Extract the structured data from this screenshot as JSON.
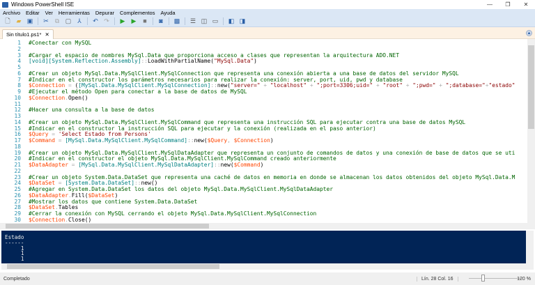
{
  "window": {
    "title": "Windows PowerShell ISE",
    "minimize": "—",
    "restore": "❐",
    "close": "✕"
  },
  "menu": [
    "Archivo",
    "Editar",
    "Ver",
    "Herramientas",
    "Depurar",
    "Complementos",
    "Ayuda"
  ],
  "toolbar": [
    {
      "icon": "new-file-icon",
      "glyph": "🗋",
      "color": "#555"
    },
    {
      "icon": "open-folder-icon",
      "glyph": "▰",
      "color": "#e0b040"
    },
    {
      "icon": "save-icon",
      "glyph": "▣",
      "color": "#2a5fa6"
    },
    {
      "sep": true
    },
    {
      "icon": "cut-icon",
      "glyph": "✂",
      "color": "#2a5fa6"
    },
    {
      "icon": "copy-icon",
      "glyph": "⧉",
      "color": "#aaa"
    },
    {
      "icon": "paste-icon",
      "glyph": "▢",
      "color": "#666"
    },
    {
      "icon": "clear-console-icon",
      "glyph": "⅄",
      "color": "#2a5fa6"
    },
    {
      "sep": true
    },
    {
      "icon": "undo-icon",
      "glyph": "↶",
      "color": "#2a5fa6"
    },
    {
      "icon": "redo-icon",
      "glyph": "↷",
      "color": "#aaa"
    },
    {
      "sep": true
    },
    {
      "icon": "run-script-icon",
      "glyph": "▶",
      "color": "#2aa52a"
    },
    {
      "icon": "run-selection-icon",
      "glyph": "▶",
      "color": "#2aa52a"
    },
    {
      "icon": "stop-icon",
      "glyph": "■",
      "color": "#777"
    },
    {
      "sep": true
    },
    {
      "icon": "remote-powershell-icon",
      "glyph": "◙",
      "color": "#2a5fa6"
    },
    {
      "sep": true
    },
    {
      "icon": "powershell-console-icon",
      "glyph": "▩",
      "color": "#2a5fa6"
    },
    {
      "sep": true
    },
    {
      "icon": "layout-top-icon",
      "glyph": "☰",
      "color": "#555"
    },
    {
      "icon": "layout-right-icon",
      "glyph": "◫",
      "color": "#555"
    },
    {
      "icon": "layout-max-icon",
      "glyph": "▭",
      "color": "#555"
    },
    {
      "sep": true
    },
    {
      "icon": "show-script-pane-icon",
      "glyph": "◧",
      "color": "#2a5fa6"
    },
    {
      "icon": "show-commands-icon",
      "glyph": "◨",
      "color": "#2a5fa6"
    }
  ],
  "tab": {
    "label": "Sin título1.ps1*",
    "close": "✕"
  },
  "editor": {
    "lines": [
      [
        [
          "c",
          "#Conectar con MySQL"
        ]
      ],
      [],
      [
        [
          "c",
          "#Cargar el espacio de nombres MySql.Data que proporciona acceso a clases que representan la arquitectura ADO.NET"
        ]
      ],
      [
        [
          "t",
          "[void][System.Reflection.Assembly]"
        ],
        [
          "o",
          "::"
        ],
        [
          "m",
          "LoadWithPartialName("
        ],
        [
          "s",
          "\"MySql.Data\""
        ],
        [
          "m",
          ")"
        ]
      ],
      [],
      [
        [
          "c",
          "#Crear un objeto MySql.Data.MySqlClient.MySqlConnection que representa una conexión abierta a una base de datos del servidor MySQL"
        ]
      ],
      [
        [
          "c",
          "#Indicar en el constructor los parámetros necesarios para realizar la conexión: server, port, uid, pwd y database"
        ]
      ],
      [
        [
          "v",
          "$Connection"
        ],
        [
          "o",
          " = "
        ],
        [
          "m",
          "("
        ],
        [
          "t",
          "[MySql.Data.MySqlClient.MySqlConnection]"
        ],
        [
          "o",
          "::"
        ],
        [
          "m",
          "new("
        ],
        [
          "s",
          "\"server=\""
        ],
        [
          "o",
          " + "
        ],
        [
          "s",
          "\"localhost\""
        ],
        [
          "o",
          " + "
        ],
        [
          "s",
          "\";port=3306;uid=\""
        ],
        [
          "o",
          " + "
        ],
        [
          "s",
          "\"root\""
        ],
        [
          "o",
          " + "
        ],
        [
          "s",
          "\";pwd=\""
        ],
        [
          "o",
          " + "
        ],
        [
          "s",
          "\";database=\""
        ],
        [
          "o",
          "+"
        ],
        [
          "s",
          "\"estado\""
        ]
      ],
      [
        [
          "c",
          "#Ejecutar el método Open para conectar a la base de datos de MySQL"
        ]
      ],
      [
        [
          "v",
          "$Connection"
        ],
        [
          "o",
          "."
        ],
        [
          "m",
          "Open()"
        ]
      ],
      [],
      [
        [
          "c",
          "#Hacer una consulta a la base de datos"
        ]
      ],
      [],
      [
        [
          "c",
          "#Crear un objeto MySql.Data.MySqlClient.MySqlCommand que representa una instrucción SQL para ejecutar contra una base de datos MySQL"
        ]
      ],
      [
        [
          "c",
          "#Indicar en el constructor la instrucción SQL para ejecutar y la conexión (realizada en el paso anterior)"
        ]
      ],
      [
        [
          "v",
          "$Query"
        ],
        [
          "o",
          " = "
        ],
        [
          "s",
          "'Select Estado from Persons'"
        ]
      ],
      [
        [
          "v",
          "$Command"
        ],
        [
          "o",
          " = "
        ],
        [
          "t",
          "[MySql.Data.MySqlClient.MySqlCommand]"
        ],
        [
          "o",
          "::"
        ],
        [
          "m",
          "new("
        ],
        [
          "v",
          "$Query"
        ],
        [
          "o",
          ", "
        ],
        [
          "v",
          "$Connection"
        ],
        [
          "m",
          ")"
        ]
      ],
      [],
      [
        [
          "c",
          "#Crear un objeto MySql.Data.MySqlClient.MySqlDataAdapter que representa un conjunto de comandos de datos y una conexión de base de datos que se uti"
        ]
      ],
      [
        [
          "c",
          "#Indicar en el constructor el objeto MySql.Data.MySqlClient.MySqlCommand creado anteriormente"
        ]
      ],
      [
        [
          "v",
          "$DataAdapter"
        ],
        [
          "o",
          " = "
        ],
        [
          "t",
          "[MySql.Data.MySqlClient.MySqlDataAdapter]"
        ],
        [
          "o",
          "::"
        ],
        [
          "m",
          "new("
        ],
        [
          "v",
          "$Command"
        ],
        [
          "m",
          ")"
        ]
      ],
      [],
      [
        [
          "c",
          "#Crear un objeto System.Data.DataSet que representa una caché de datos en memoria en donde se almacenan los datos obtenidos del objeto MySql.Data.M"
        ]
      ],
      [
        [
          "v",
          "$DataSet"
        ],
        [
          "o",
          " = "
        ],
        [
          "t",
          "[System.Data.DataSet]"
        ],
        [
          "o",
          "::"
        ],
        [
          "m",
          "new()"
        ]
      ],
      [
        [
          "c",
          "#Agregar en System.Data.DataSet los datos del objeto MySql.Data.MySqlClient.MySqlDataAdapter"
        ]
      ],
      [
        [
          "v",
          "$DataAdapter"
        ],
        [
          "o",
          "."
        ],
        [
          "m",
          "Fill("
        ],
        [
          "v",
          "$DataSet"
        ],
        [
          "m",
          ")"
        ]
      ],
      [
        [
          "c",
          "#Mostrar los datos que contiene System.Data.DataSet"
        ]
      ],
      [
        [
          "v",
          "$DataSet"
        ],
        [
          "o",
          "."
        ],
        [
          "m",
          "Tables"
        ]
      ],
      [
        [
          "c",
          "#Cerrar la conexión con MySQL cerrando el objeto MySql.Data.MySqlClient.MySqlConnection"
        ]
      ],
      [
        [
          "v",
          "$Connection"
        ],
        [
          "o",
          "."
        ],
        [
          "m",
          "Close()"
        ]
      ]
    ]
  },
  "console": {
    "output": "Estado\n------\n     1\n     1\n     1"
  },
  "status": {
    "text": "Completado",
    "position": "Lín. 28  Col. 16",
    "zoom": "120 %",
    "zoom_percent": 120
  }
}
